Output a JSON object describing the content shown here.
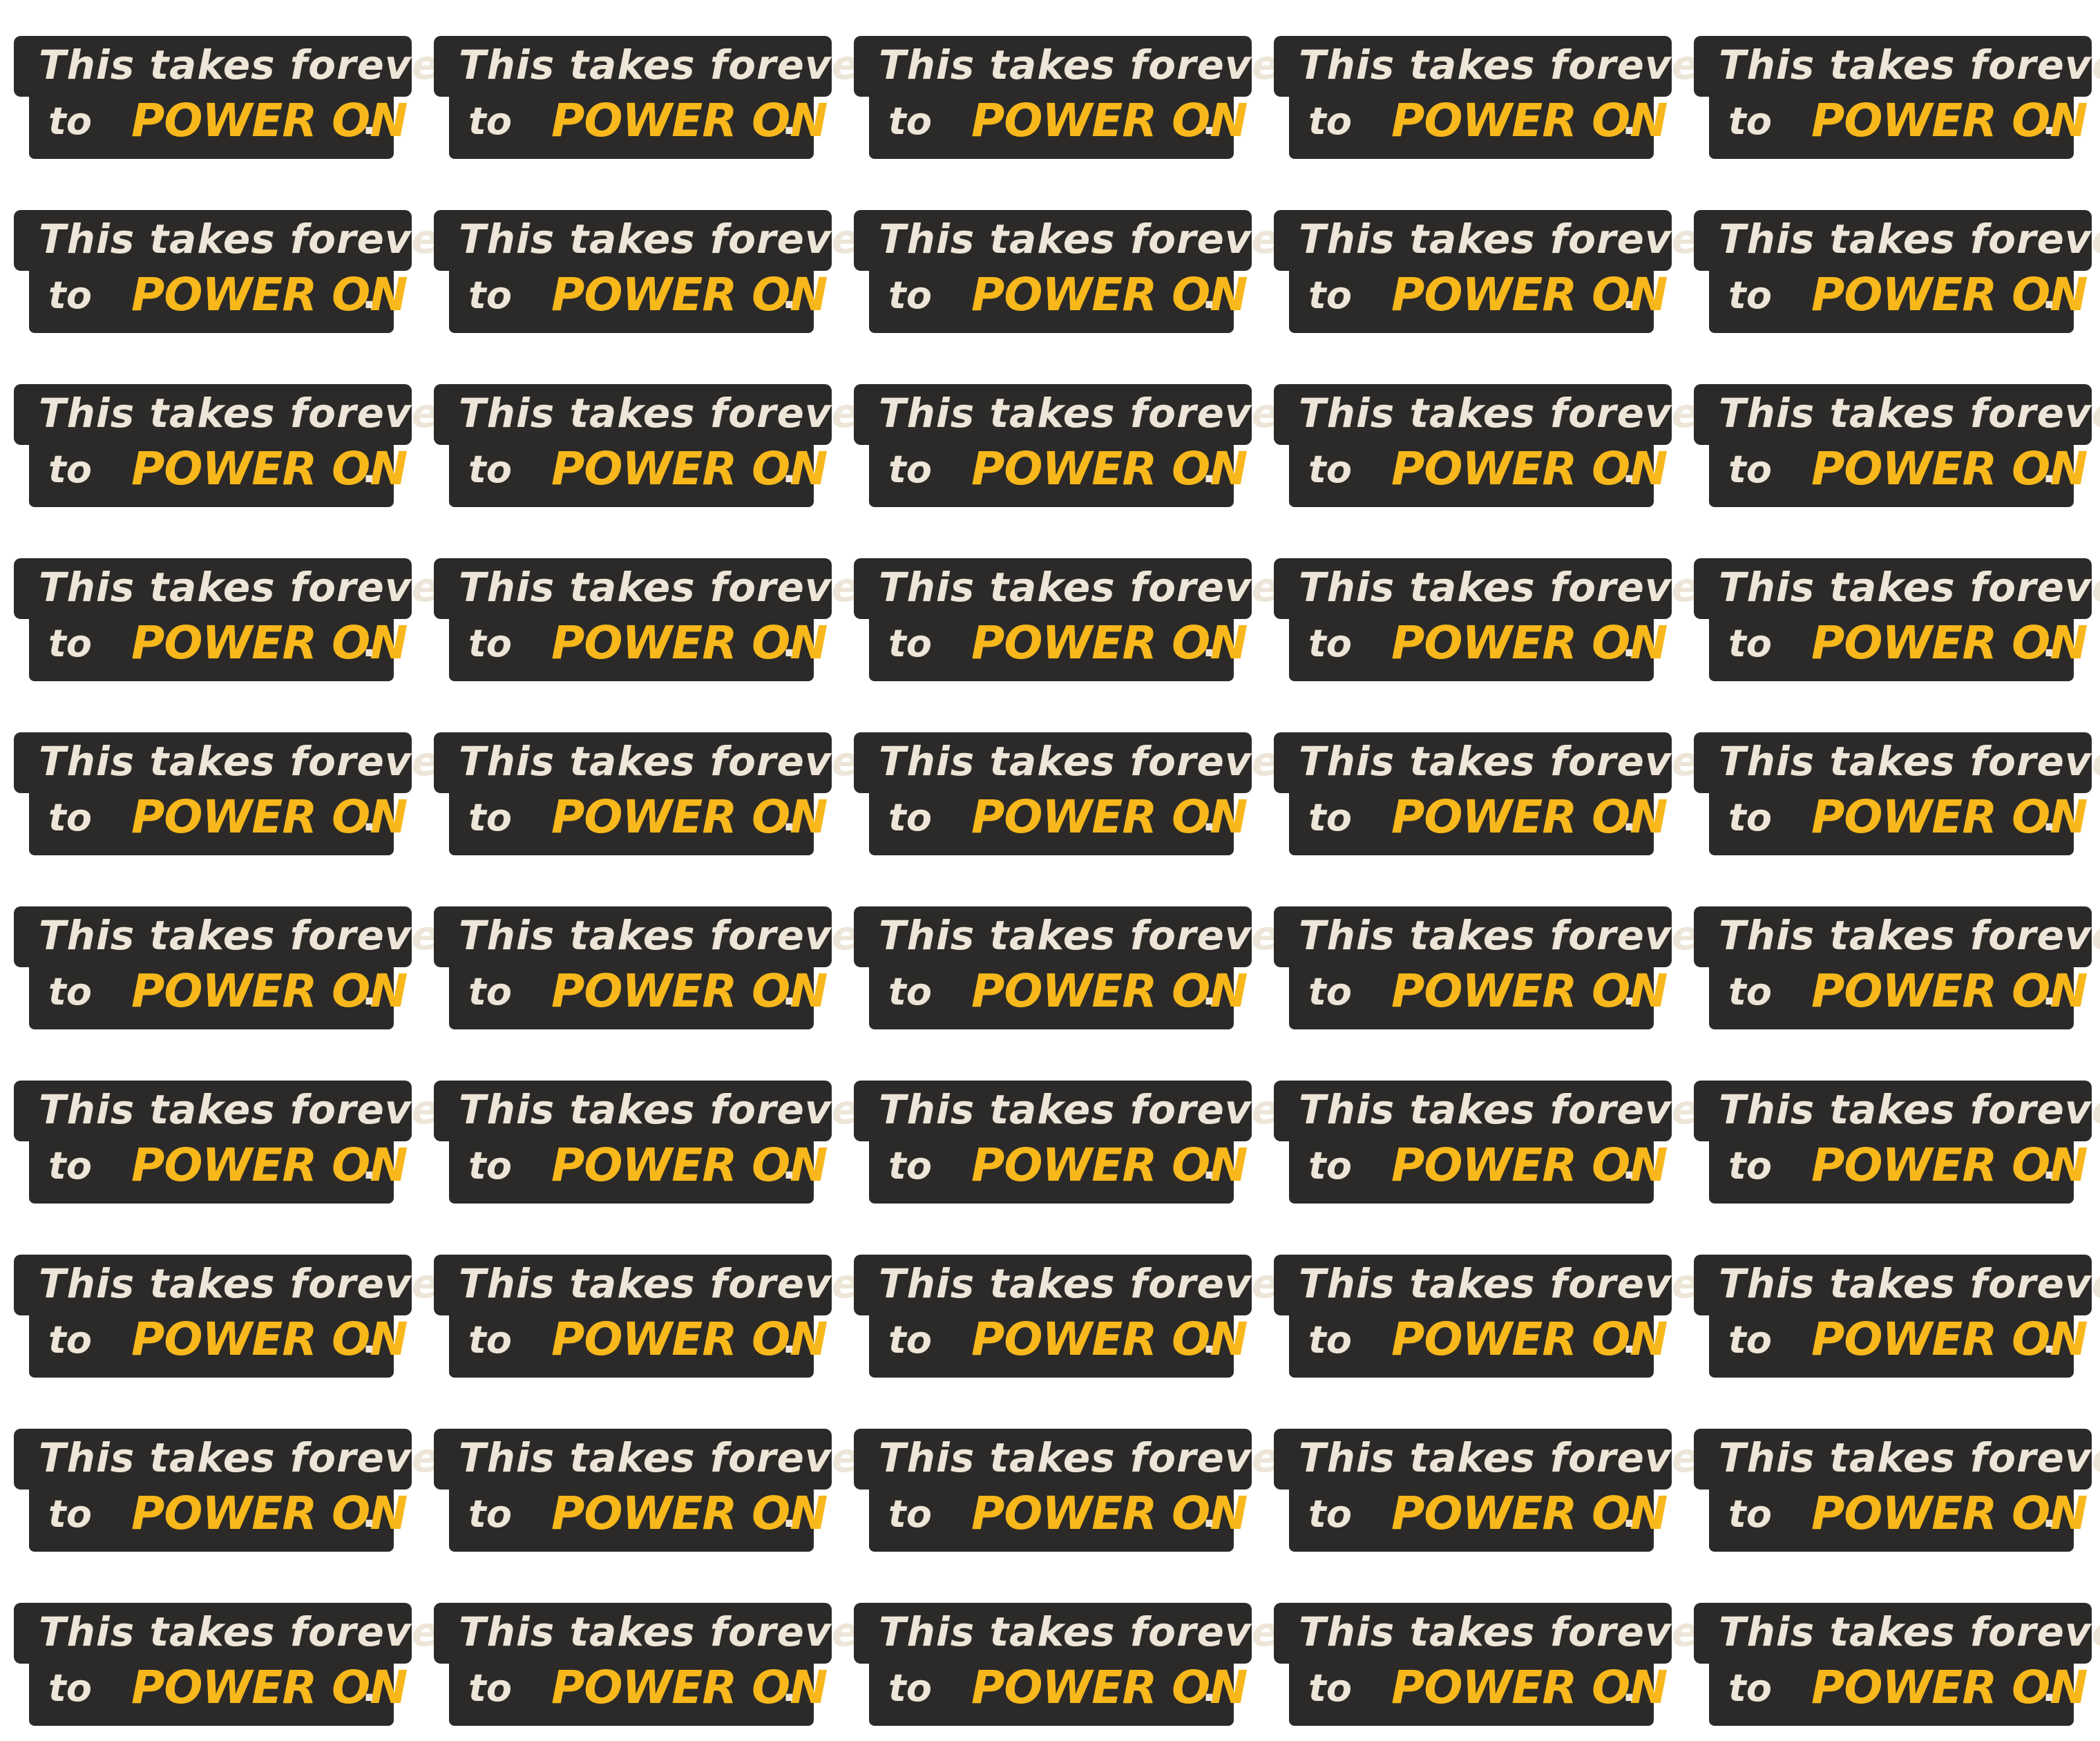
{
  "colors": {
    "background": "#ffffff",
    "bar": "#2b2a28",
    "text_light": "#ede6d8",
    "text_accent": "#f8b81c"
  },
  "sticker": {
    "line1": "This takes forever",
    "to": "to",
    "highlight": "POWER ON",
    "dot": "."
  },
  "grid": {
    "rows": 10,
    "columns": 5
  }
}
